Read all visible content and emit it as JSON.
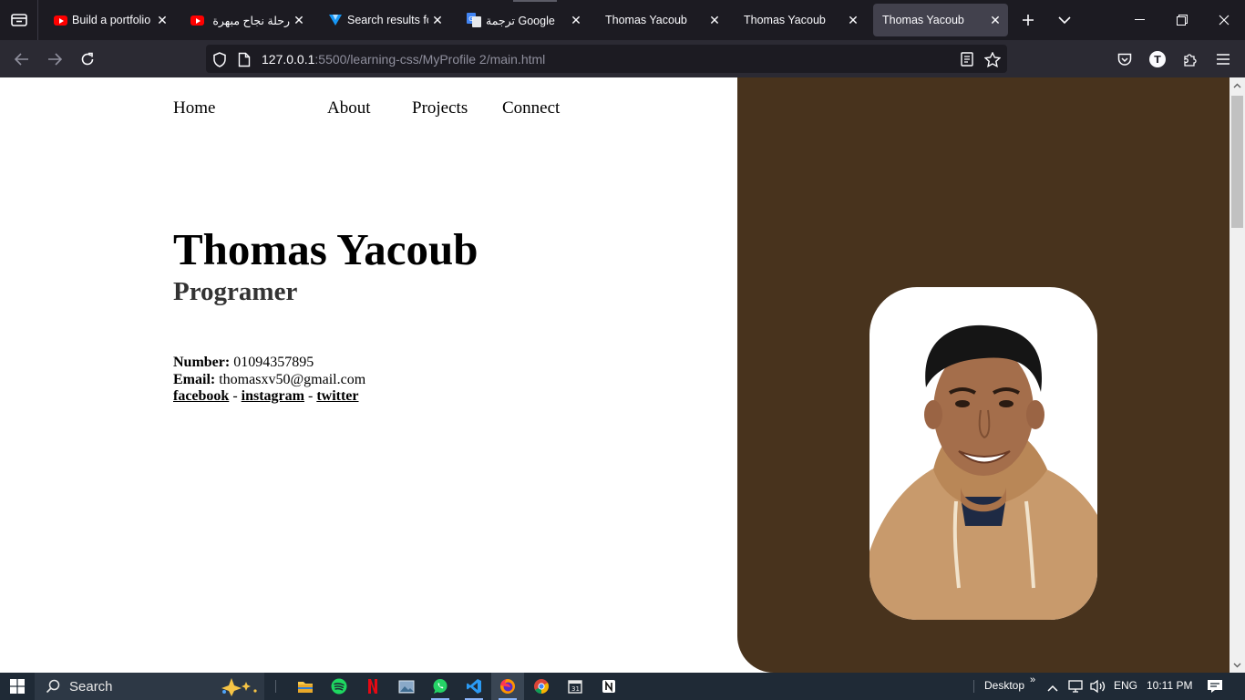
{
  "browser": {
    "tabs": [
      {
        "title": "Build a portfolio w",
        "favicon": "youtube-icon"
      },
      {
        "title": "رحلة نجاح مبهرة",
        "favicon": "youtube-icon"
      },
      {
        "title": "Search results for",
        "favicon": "vuetify-icon"
      },
      {
        "title": "ترجمة Google",
        "favicon": "google-translate-icon"
      },
      {
        "title": "Thomas Yacoub",
        "favicon": ""
      },
      {
        "title": "Thomas Yacoub",
        "favicon": ""
      },
      {
        "title": "Thomas Yacoub",
        "favicon": "",
        "active": true
      }
    ],
    "url": {
      "host": "127.0.0.1",
      "path": ":5500/learning-css/MyProfile 2/main.html"
    },
    "profile_initial": "T"
  },
  "page": {
    "nav": [
      "Home",
      "About",
      "Projects",
      "Connect"
    ],
    "name": "Thomas Yacoub",
    "role": "Programer",
    "contact": {
      "number_label": "Number:",
      "number": "01094357895",
      "email_label": "Email:",
      "email": "thomasxv50@gmail.com",
      "links": [
        "facebook",
        "instagram",
        "twitter"
      ],
      "separator": "-"
    },
    "panel_color": "#48331d"
  },
  "taskbar": {
    "search_label": "Search",
    "desktop_label": "Desktop",
    "language": "ENG",
    "time": "10:11 PM"
  }
}
